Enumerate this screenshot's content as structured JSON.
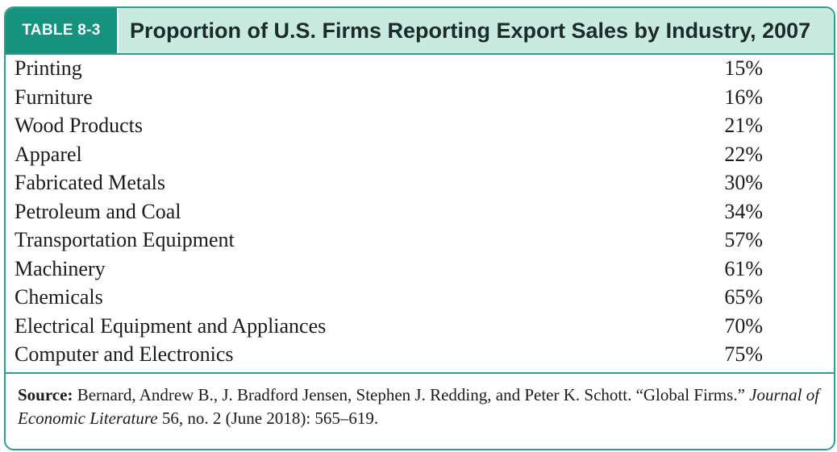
{
  "table": {
    "tag": "TABLE 8-3",
    "title": "Proportion of U.S. Firms Reporting Export Sales by Industry, 2007",
    "rows": [
      {
        "industry": "Printing",
        "share": "15%"
      },
      {
        "industry": "Furniture",
        "share": "16%"
      },
      {
        "industry": "Wood Products",
        "share": "21%"
      },
      {
        "industry": "Apparel",
        "share": "22%"
      },
      {
        "industry": "Fabricated Metals",
        "share": "30%"
      },
      {
        "industry": "Petroleum and Coal",
        "share": "34%"
      },
      {
        "industry": "Transportation Equipment",
        "share": "57%"
      },
      {
        "industry": "Machinery",
        "share": "61%"
      },
      {
        "industry": "Chemicals",
        "share": "65%"
      },
      {
        "industry": "Electrical Equipment and Appliances",
        "share": "70%"
      },
      {
        "industry": "Computer and Electronics",
        "share": "75%"
      }
    ],
    "source": {
      "label": "Source:",
      "text_before": " Bernard, Andrew B., J. Bradford Jensen, Stephen J. Redding, and Peter K. Schott. “Global Firms.” ",
      "journal": "Journal of Economic Literature",
      "text_after": " 56, no. 2 (June 2018): 565–619."
    }
  }
}
